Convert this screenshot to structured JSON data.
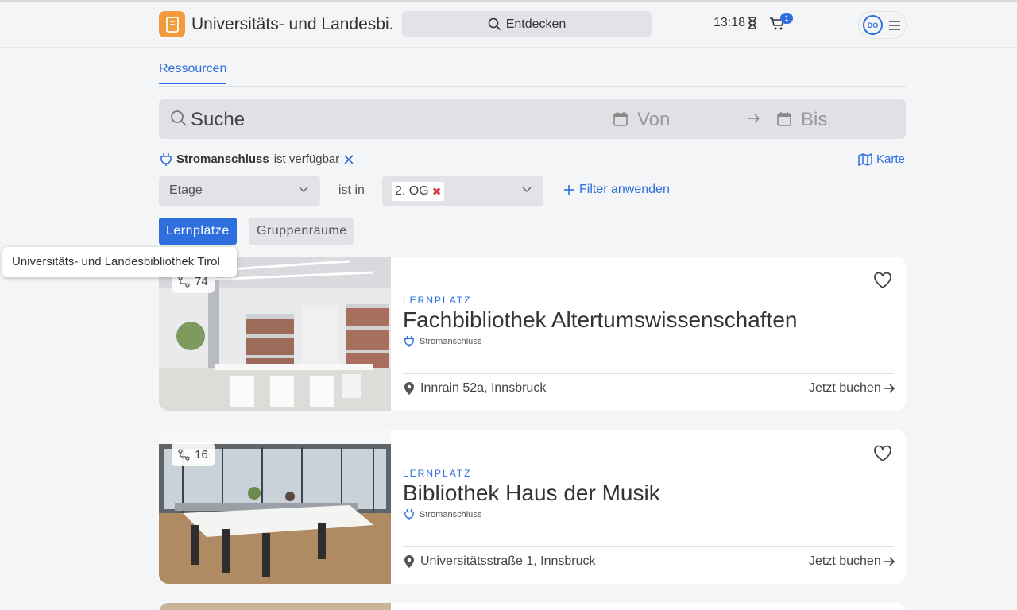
{
  "header": {
    "title": "Universitäts- und Landesbi...",
    "discover_label": "Entdecken",
    "time": "13:18",
    "cart_count": "1",
    "avatar_initials": "DO"
  },
  "tabs": [
    {
      "label": "Ressourcen",
      "active": true
    }
  ],
  "search": {
    "placeholder": "Suche",
    "from_placeholder": "Von",
    "to_placeholder": "Bis"
  },
  "active_filter": {
    "name": "Stromanschluss",
    "condition": "ist verfügbar"
  },
  "map_link": "Karte",
  "filter_row": {
    "attribute": "Etage",
    "operator": "ist in",
    "value_chip": "2. OG",
    "apply_label": "Filter anwenden"
  },
  "types": [
    {
      "label": "Lernplätze",
      "active": true
    },
    {
      "label": "Gruppenräume",
      "active": false
    }
  ],
  "tooltip": "Universitäts- und Landesbibliothek Tirol",
  "cards": [
    {
      "count": "74",
      "type": "LERNPLATZ",
      "title": "Fachbibliothek Altertumswissenschaften",
      "feature": "Stromanschluss",
      "address": "Innrain 52a, Innsbruck",
      "book_label": "Jetzt buchen"
    },
    {
      "count": "16",
      "type": "LERNPLATZ",
      "title": "Bibliothek Haus der Musik",
      "feature": "Stromanschluss",
      "address": "Universitätsstraße 1, Innsbruck",
      "book_label": "Jetzt buchen"
    }
  ],
  "colors": {
    "accent": "#2f6fdd",
    "logo": "#f39a3b",
    "remove": "#d93a4a"
  }
}
